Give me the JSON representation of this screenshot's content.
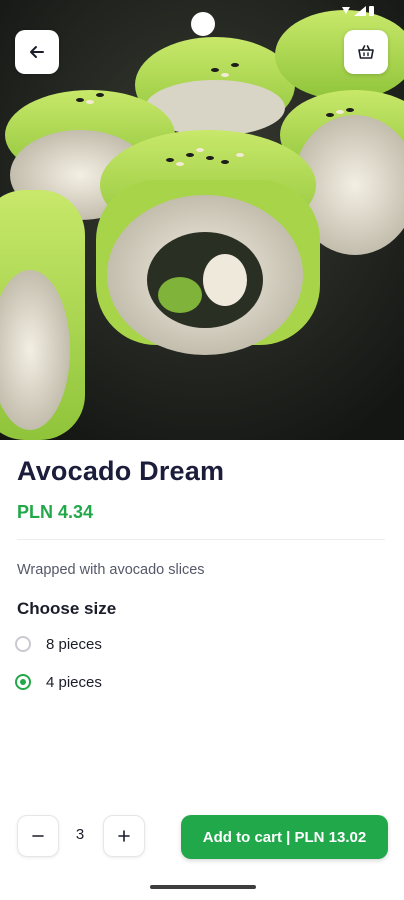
{
  "product": {
    "name": "Avocado Dream",
    "price": "PLN 4.34",
    "description": "Wrapped with avocado slices"
  },
  "size_selector": {
    "heading": "Choose size",
    "options": [
      {
        "label": "8 pieces",
        "selected": false
      },
      {
        "label": "4 pieces",
        "selected": true
      }
    ]
  },
  "cart_bar": {
    "quantity": "3",
    "add_label": "Add to cart | PLN 13.02"
  },
  "colors": {
    "accent_green": "#21a84b",
    "title_navy": "#1b1d3a"
  },
  "icons": {
    "back": "arrow-left-icon",
    "basket": "basket-icon",
    "minus": "minus-icon",
    "plus": "plus-icon"
  }
}
